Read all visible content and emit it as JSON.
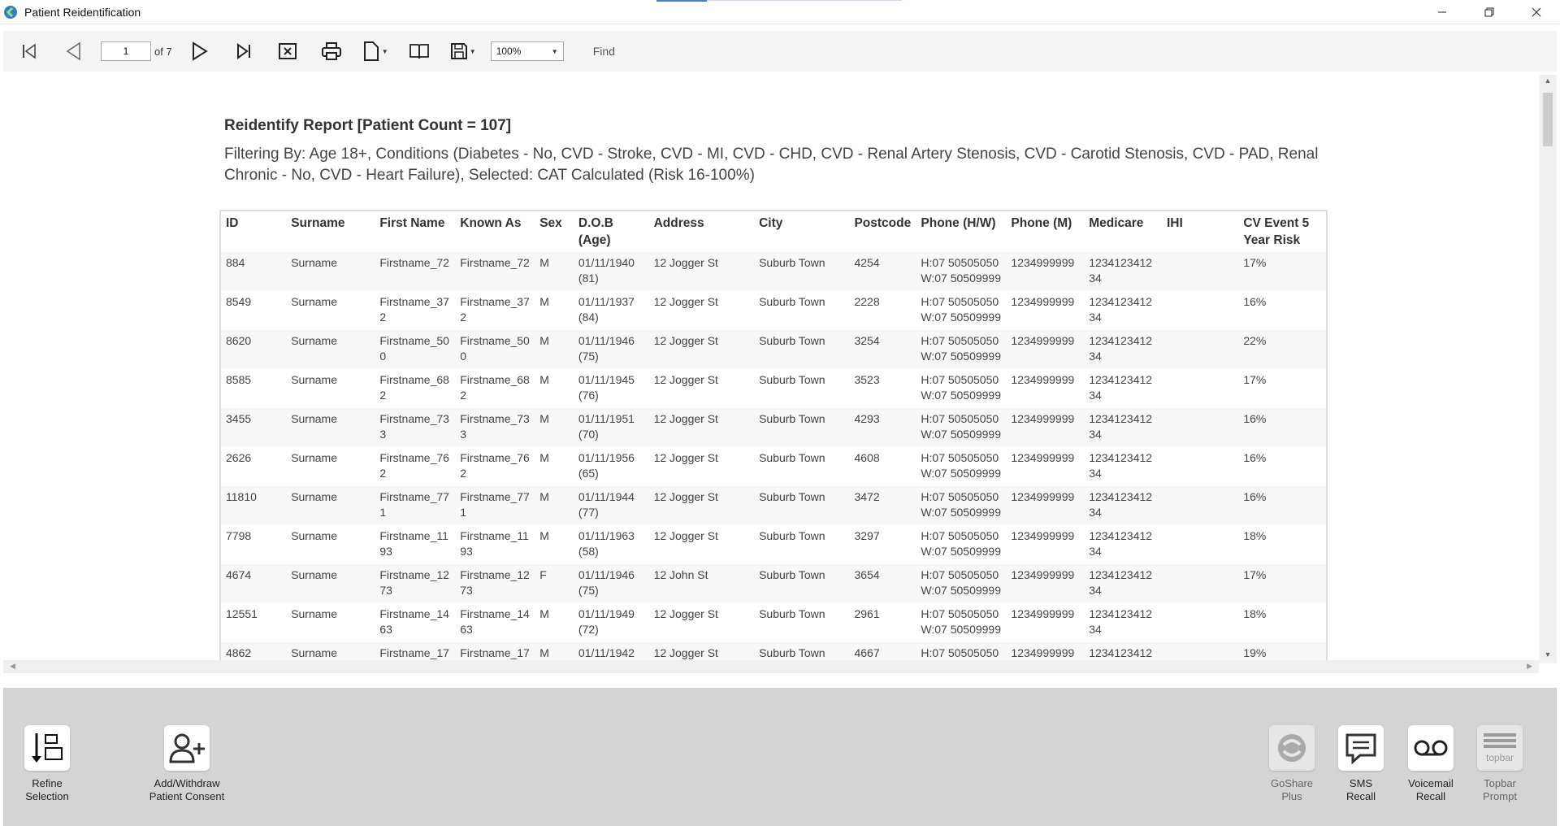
{
  "window": {
    "title": "Patient Reidentification",
    "accent_color": "#3a7bd5"
  },
  "toolbar": {
    "current_page": "1",
    "page_count_text": "of 7",
    "zoom": "100%",
    "find_label": "Find"
  },
  "report": {
    "title": "Reidentify Report  [Patient Count = 107]",
    "filter": "Filtering By: Age 18+, Conditions (Diabetes - No, CVD - Stroke, CVD - MI, CVD - CHD, CVD - Renal Artery Stenosis, CVD - Carotid Stenosis, CVD - PAD, Renal Chronic - No, CVD - Heart Failure), Selected: CAT Calculated (Risk 16-100%)",
    "columns": [
      "ID",
      "Surname",
      "First Name",
      "Known As",
      "Sex",
      "D.O.B\n(Age)",
      "Address",
      "City",
      "Postcode",
      "Phone (H/W)",
      "Phone (M)",
      "Medicare",
      "IHI",
      "CV Event 5\nYear Risk"
    ],
    "rows": [
      [
        "884",
        "Surname",
        "Firstname_72",
        "Firstname_72",
        "M",
        "01/11/1940\n(81)",
        "12 Jogger St",
        "Suburb Town",
        "4254",
        "H:07 50505050\nW:07 50509999",
        "1234999999",
        "1234123412\n34",
        "",
        "17%"
      ],
      [
        "8549",
        "Surname",
        "Firstname_37\n2",
        "Firstname_37\n2",
        "M",
        "01/11/1937\n(84)",
        "12 Jogger St",
        "Suburb Town",
        "2228",
        "H:07 50505050\nW:07 50509999",
        "1234999999",
        "1234123412\n34",
        "",
        "16%"
      ],
      [
        "8620",
        "Surname",
        "Firstname_50\n0",
        "Firstname_50\n0",
        "M",
        "01/11/1946\n(75)",
        "12 Jogger St",
        "Suburb Town",
        "3254",
        "H:07 50505050\nW:07 50509999",
        "1234999999",
        "1234123412\n34",
        "",
        "22%"
      ],
      [
        "8585",
        "Surname",
        "Firstname_68\n2",
        "Firstname_68\n2",
        "M",
        "01/11/1945\n(76)",
        "12 Jogger St",
        "Suburb Town",
        "3523",
        "H:07 50505050\nW:07 50509999",
        "1234999999",
        "1234123412\n34",
        "",
        "17%"
      ],
      [
        "3455",
        "Surname",
        "Firstname_73\n3",
        "Firstname_73\n3",
        "M",
        "01/11/1951\n(70)",
        "12 Jogger St",
        "Suburb Town",
        "4293",
        "H:07 50505050\nW:07 50509999",
        "1234999999",
        "1234123412\n34",
        "",
        "16%"
      ],
      [
        "2626",
        "Surname",
        "Firstname_76\n2",
        "Firstname_76\n2",
        "M",
        "01/11/1956\n(65)",
        "12 Jogger St",
        "Suburb Town",
        "4608",
        "H:07 50505050\nW:07 50509999",
        "1234999999",
        "1234123412\n34",
        "",
        "16%"
      ],
      [
        "11810",
        "Surname",
        "Firstname_77\n1",
        "Firstname_77\n1",
        "M",
        "01/11/1944\n(77)",
        "12 Jogger St",
        "Suburb Town",
        "3472",
        "H:07 50505050\nW:07 50509999",
        "1234999999",
        "1234123412\n34",
        "",
        "16%"
      ],
      [
        "7798",
        "Surname",
        "Firstname_11\n93",
        "Firstname_11\n93",
        "M",
        "01/11/1963\n(58)",
        "12 Jogger St",
        "Suburb Town",
        "3297",
        "H:07 50505050\nW:07 50509999",
        "1234999999",
        "1234123412\n34",
        "",
        "18%"
      ],
      [
        "4674",
        "Surname",
        "Firstname_12\n73",
        "Firstname_12\n73",
        "F",
        "01/11/1946\n(75)",
        "12 John St",
        "Suburb Town",
        "3654",
        "H:07 50505050\nW:07 50509999",
        "1234999999",
        "1234123412\n34",
        "",
        "17%"
      ],
      [
        "12551",
        "Surname",
        "Firstname_14\n63",
        "Firstname_14\n63",
        "M",
        "01/11/1949\n(72)",
        "12 Jogger St",
        "Suburb Town",
        "2961",
        "H:07 50505050\nW:07 50509999",
        "1234999999",
        "1234123412\n34",
        "",
        "18%"
      ],
      [
        "4862",
        "Surname",
        "Firstname_17",
        "Firstname_17",
        "M",
        "01/11/1942",
        "12 Jogger St",
        "Suburb Town",
        "4667",
        "H:07 50505050",
        "1234999999",
        "1234123412",
        "",
        "19%"
      ]
    ]
  },
  "actions": {
    "refine": "Refine\nSelection",
    "consent": "Add/Withdraw\nPatient Consent",
    "goshare": "GoShare\nPlus",
    "sms": "SMS\nRecall",
    "voicemail": "Voicemail\nRecall",
    "topbar": "Topbar\nPrompt",
    "topbar_icon_text": "topbar"
  }
}
